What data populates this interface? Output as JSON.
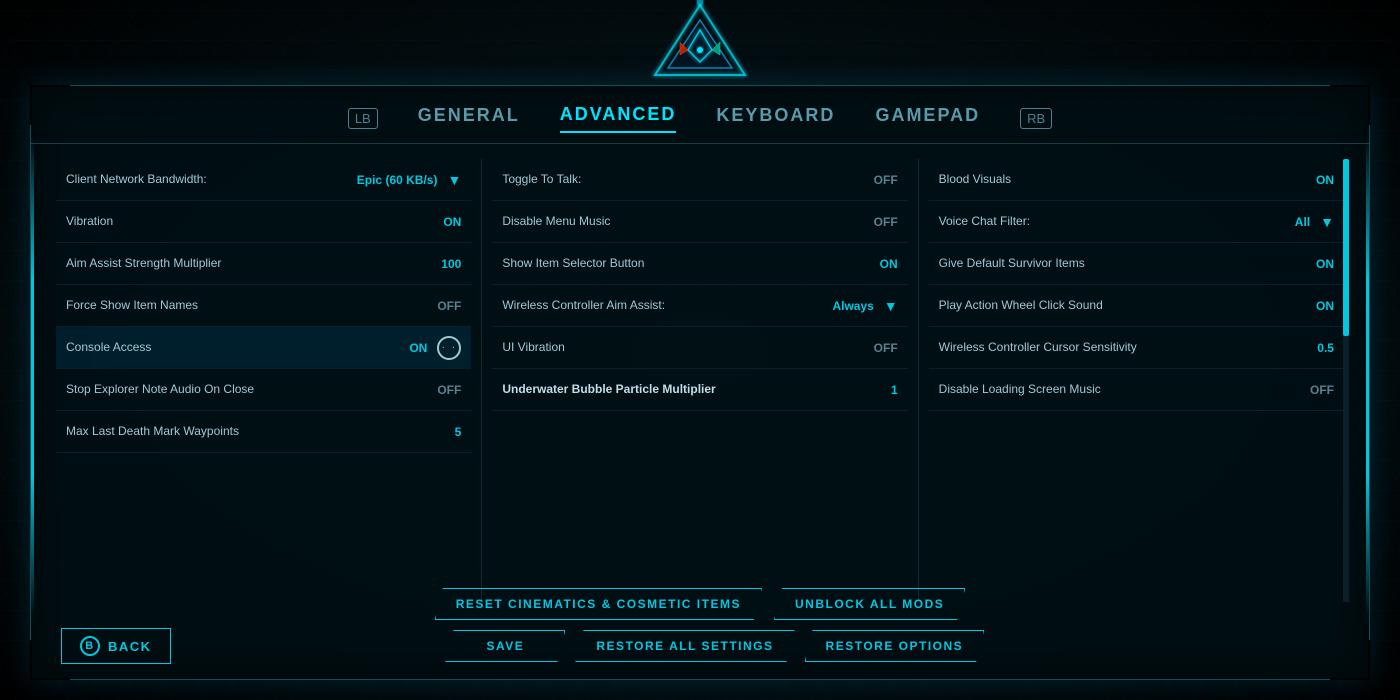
{
  "logo": {
    "alt": "ARK Logo"
  },
  "tabs": {
    "left_nav": "LB",
    "right_nav": "RB",
    "items": [
      {
        "id": "general",
        "label": "GENERAL",
        "active": false
      },
      {
        "id": "advanced",
        "label": "ADVANCED",
        "active": true
      },
      {
        "id": "keyboard",
        "label": "KEYBOARD",
        "active": false
      },
      {
        "id": "gamepad",
        "label": "GAMEPAD",
        "active": false
      }
    ]
  },
  "columns": {
    "col1": {
      "settings": [
        {
          "label": "Client Network Bandwidth:",
          "value": "Epic (60 KB/s)",
          "type": "dropdown"
        },
        {
          "label": "Vibration",
          "value": "ON",
          "type": "toggle"
        },
        {
          "label": "Aim Assist Strength Multiplier",
          "value": "100",
          "type": "number"
        },
        {
          "label": "Force Show Item Names",
          "value": "OFF",
          "type": "toggle"
        },
        {
          "label": "Console Access",
          "value": "ON",
          "type": "toggle_icon"
        },
        {
          "label": "Stop Explorer Note Audio On Close",
          "value": "OFF",
          "type": "toggle"
        },
        {
          "label": "Max Last Death Mark Waypoints",
          "value": "5",
          "type": "number"
        }
      ]
    },
    "col2": {
      "settings": [
        {
          "label": "Toggle To Talk:",
          "value": "OFF",
          "type": "toggle"
        },
        {
          "label": "Disable Menu Music",
          "value": "OFF",
          "type": "toggle"
        },
        {
          "label": "Show Item Selector Button",
          "value": "ON",
          "type": "toggle"
        },
        {
          "label": "Wireless Controller Aim Assist:",
          "value": "Always",
          "type": "dropdown"
        },
        {
          "label": "UI Vibration",
          "value": "OFF",
          "type": "toggle"
        },
        {
          "label": "Underwater Bubble Particle Multiplier",
          "value": "1",
          "type": "number",
          "bold": true
        }
      ]
    },
    "col3": {
      "settings": [
        {
          "label": "Blood Visuals",
          "value": "ON",
          "type": "toggle"
        },
        {
          "label": "Voice Chat Filter:",
          "value": "All",
          "type": "dropdown"
        },
        {
          "label": "Give Default Survivor Items",
          "value": "ON",
          "type": "toggle"
        },
        {
          "label": "Play Action Wheel Click Sound",
          "value": "ON",
          "type": "toggle"
        },
        {
          "label": "Wireless Controller Cursor Sensitivity",
          "value": "0.5",
          "type": "number"
        },
        {
          "label": "Disable Loading Screen Music",
          "value": "OFF",
          "type": "toggle"
        }
      ]
    }
  },
  "buttons": {
    "back": "BACK",
    "back_icon": "B",
    "reset_cinematics": "RESET CINEMATICS & COSMETIC ITEMS",
    "unblock_mods": "UNBLOCK ALL MODS",
    "save": "SAVE",
    "restore_all": "RESTORE ALL SETTINGS",
    "restore_options": "RESTORE OPTIONS"
  }
}
